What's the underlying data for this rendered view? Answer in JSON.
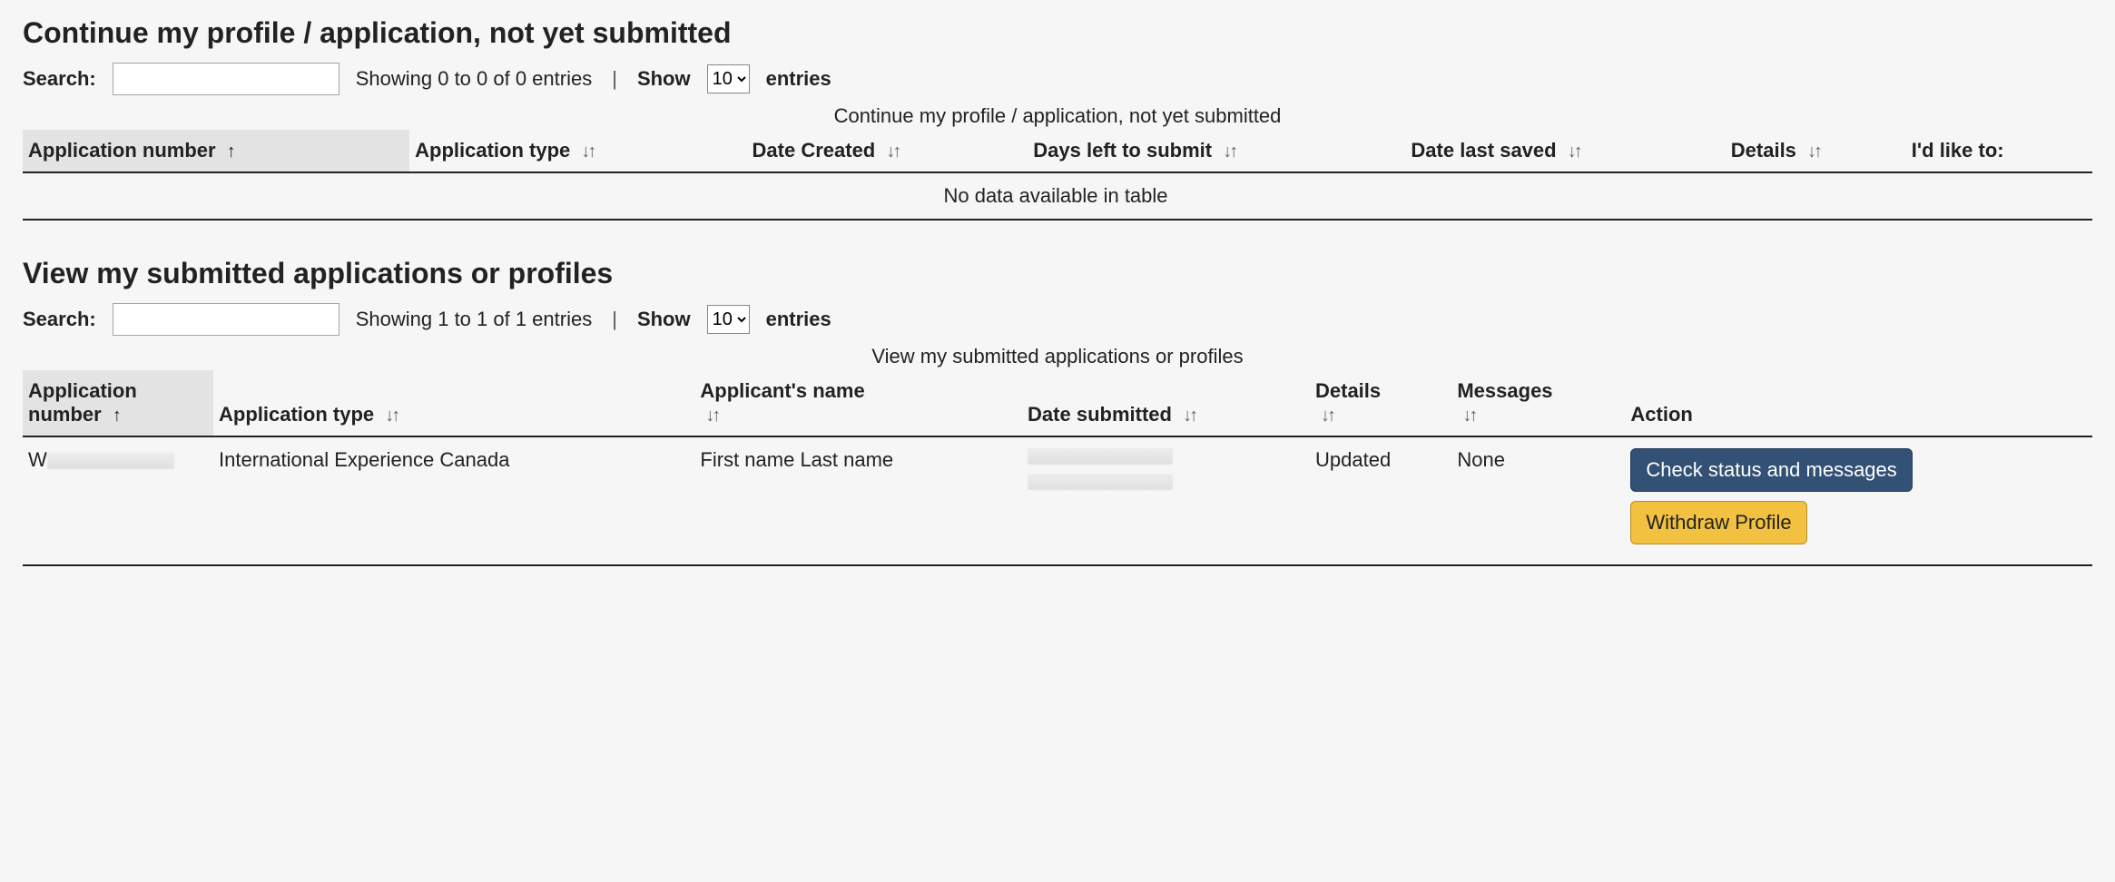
{
  "section1": {
    "title": "Continue my profile / application, not yet submitted",
    "search_label": "Search:",
    "search_value": "",
    "showing_text": "Showing 0 to 0 of 0 entries",
    "show_label": "Show",
    "entries_label": "entries",
    "entries_value": "10",
    "caption": "Continue my profile / application, not yet submitted",
    "columns": {
      "app_number": "Application number",
      "app_type": "Application type",
      "date_created": "Date Created",
      "days_left": "Days left to submit",
      "date_saved": "Date last saved",
      "details": "Details",
      "id_like": "I'd like to:"
    },
    "no_data": "No data available in table"
  },
  "section2": {
    "title": "View my submitted applications or profiles",
    "search_label": "Search:",
    "search_value": "",
    "showing_text": "Showing 1 to 1 of 1 entries",
    "show_label": "Show",
    "entries_label": "entries",
    "entries_value": "10",
    "caption": "View my submitted applications or profiles",
    "columns": {
      "app_number": "Application number",
      "app_type": "Application type",
      "applicant_name": "Applicant's name",
      "date_submitted": "Date submitted",
      "details": "Details",
      "messages": "Messages",
      "action": "Action"
    },
    "row": {
      "app_number_prefix": "W",
      "app_type": "International Experience Canada",
      "applicant_name": "First name Last name",
      "details": "Updated",
      "messages": "None",
      "btn_check": "Check status and messages",
      "btn_withdraw": "Withdraw Profile"
    }
  }
}
